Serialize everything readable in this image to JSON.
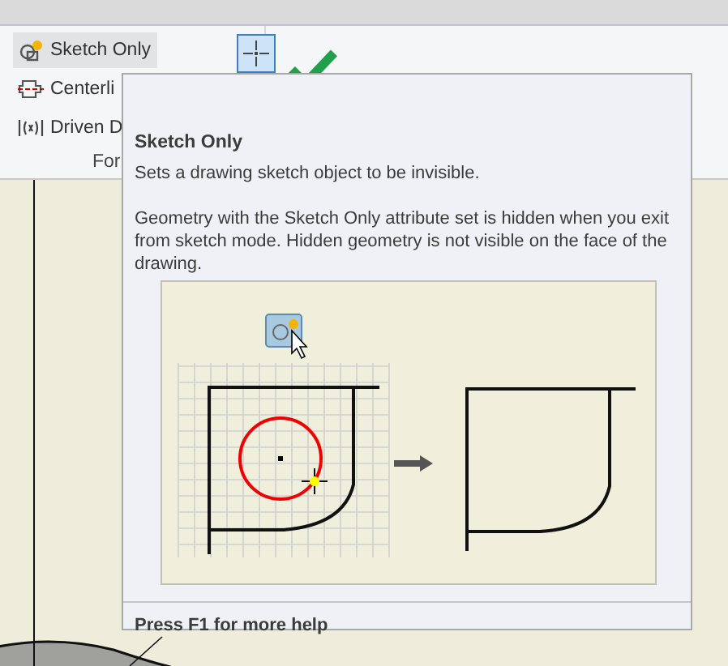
{
  "ribbon": {
    "items": [
      {
        "label": "Sketch Only",
        "kind": "sketch",
        "selected": true
      },
      {
        "label": "Centerli",
        "kind": "centerline",
        "selected": false
      },
      {
        "label": "Driven D",
        "kind": "driven",
        "selected": false
      }
    ],
    "panel_label": "For",
    "crosshair_selected": true
  },
  "tooltip": {
    "title": "Sketch Only",
    "summary": "Sets a drawing sketch object to be invisible.",
    "description": "Geometry with the Sketch Only attribute set is hidden when you exit from sketch mode. Hidden geometry is not visible on the face of the drawing.",
    "footer": "Press F1 for more help"
  }
}
